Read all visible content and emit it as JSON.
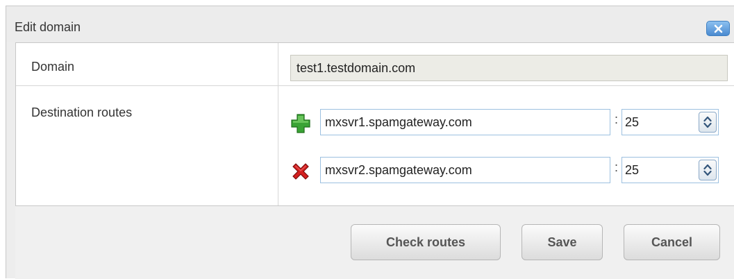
{
  "dialog": {
    "title": "Edit domain",
    "close_icon": "close-x-icon"
  },
  "form": {
    "domain_label": "Domain",
    "domain_value": "test1.testdomain.com",
    "routes_label": "Destination routes",
    "routes": [
      {
        "icon": "add-plus-icon",
        "icon_color": "#3aa335",
        "host": "mxsvr1.spamgateway.com",
        "separator": ":",
        "port": "25"
      },
      {
        "icon": "remove-x-icon",
        "icon_color": "#d42020",
        "host": "mxsvr2.spamgateway.com",
        "separator": ":",
        "port": "25"
      }
    ]
  },
  "buttons": {
    "check_routes": "Check routes",
    "save": "Save",
    "cancel": "Cancel"
  },
  "colors": {
    "accent": "#4a8ad0",
    "input_border": "#9cc0e0",
    "readonly_bg": "#ecece6"
  }
}
